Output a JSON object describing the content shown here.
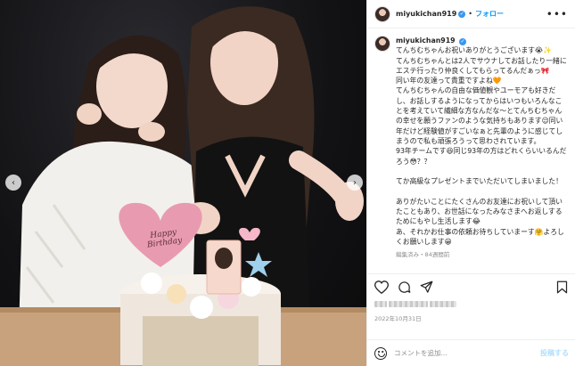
{
  "post": {
    "username": "miyukichan919",
    "follow_label": "フォロー",
    "more_label": "•••",
    "dot": "•",
    "caption": {
      "username": "miyukichan919",
      "text": "てんちむちゃんお祝いありがとうございます😭✨\nてんちむちゃんとは2人でサウナしてお話したり一緒にエステ行ったり仲良くしてもらってるんだぁっ🎀\n同い年の友達って貴重ですよね🧡\nてんちむちゃんの自由な価値観やユーモアも好きだし、お話しするようになってからはいつもいろんなことを考えていて繊細な方なんだな～とてんちむちゃんの幸せを願うファンのような気持ちもあります😌同い年だけど経験値がすごいなぁと先輩のように感じてしまうので私も頑張ろうって思わされています。\n93年チームです😆同じ93年の方はどれくらいいるんだろう😳？？\n\nてか高級なプレゼントまでいただいてしまいました！\n\nありがたいことにたくさんのお友達にお祝いして頂いたこともあり、お世話になったみなさまへお返しするためにもやし生活します😂\nあ、それかお仕事の依頼お待ちしていまーす🤗よろしくお願いします😁"
    },
    "edited_meta": "編集済み・84週間前",
    "date": "2022年10月31日",
    "comment_placeholder": "コメントを追加...",
    "post_button": "投稿する"
  },
  "media": {
    "cake_topper_text_line1": "Happy",
    "cake_topper_text_line2": "Birthday",
    "nav_left": "‹",
    "nav_right": "›"
  },
  "colors": {
    "link_blue": "#0095f6",
    "verified_blue": "#3897f0",
    "meta_gray": "#8e8e8e",
    "balloon_pink": "#e89bb0"
  },
  "icons": [
    "verified-badge-icon",
    "heart-icon",
    "comment-icon",
    "share-icon",
    "bookmark-icon",
    "emoji-icon",
    "more-options-icon",
    "chevron-left-icon",
    "chevron-right-icon"
  ]
}
